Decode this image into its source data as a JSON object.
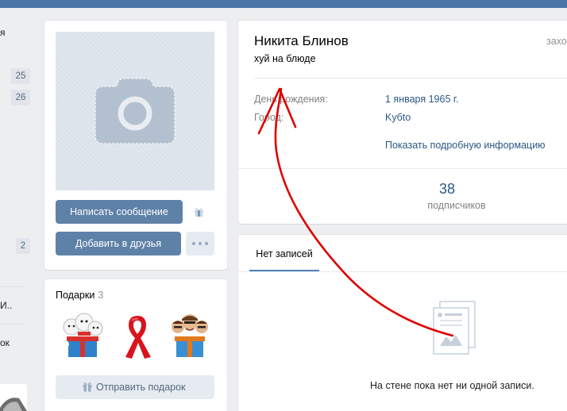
{
  "sidebar": {
    "frag1": "я",
    "badges": [
      "25",
      "26",
      "2"
    ],
    "frag2": "И..",
    "frag3": "ок"
  },
  "avatar": {
    "icon": "camera-icon",
    "message_button": "Написать сообщение",
    "gift_icon": "gift-icon",
    "add_friend_button": "Добавить в друзья",
    "more_icon": "more-dots-icon"
  },
  "gifts": {
    "title": "Подарки",
    "count": "3",
    "items": [
      "gift-polar-bears",
      "gift-red-ribbon",
      "gift-characters-box"
    ],
    "send_button": "Отправить подарок",
    "send_icon": "gift-icon"
  },
  "profile": {
    "name": "Никита Блинов",
    "status": "хуй на блюде",
    "online": "захо",
    "birthday_label": "День рождения:",
    "birthday_value": "1 января 1965 г.",
    "city_label": "Город:",
    "city_value": "Kyбto",
    "details_link": "Показать подробную информацию",
    "followers_count": "38",
    "followers_label": "подписчиков"
  },
  "wall": {
    "tab": "Нет записей",
    "empty_message": "На стене пока нет ни одной записи.",
    "empty_icon": "document-icon"
  },
  "colors": {
    "header": "#4a76a8",
    "button": "#5e81a8",
    "link": "#2a5885",
    "annotation": "#e00000"
  }
}
